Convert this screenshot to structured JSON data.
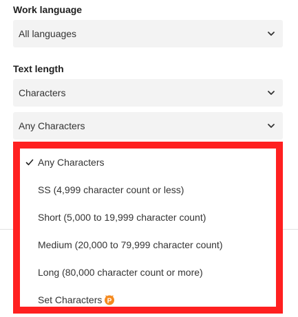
{
  "work_language": {
    "label": "Work language",
    "selected": "All languages"
  },
  "text_length": {
    "label": "Text length",
    "unit_selected": "Characters",
    "range_selected": "Any Characters"
  },
  "dropdown": {
    "items": [
      {
        "label": "Any Characters",
        "checked": true
      },
      {
        "label": "SS (4,999 character count or less)",
        "checked": false
      },
      {
        "label": "Short (5,000 to 19,999 character count)",
        "checked": false
      },
      {
        "label": "Medium (20,000 to 79,999 character count)",
        "checked": false
      },
      {
        "label": "Long (80,000 character count or more)",
        "checked": false
      },
      {
        "label": "Set Characters",
        "checked": false,
        "badge": "P"
      }
    ]
  },
  "colors": {
    "highlight_border": "#ff2020",
    "select_background": "#f3f3f3",
    "premium_badge": "#f58a1f"
  },
  "icons": {
    "select_arrow": "chevron-down-icon",
    "selected_marker": "checkmark-icon",
    "premium_marker": "premium-badge-icon"
  }
}
